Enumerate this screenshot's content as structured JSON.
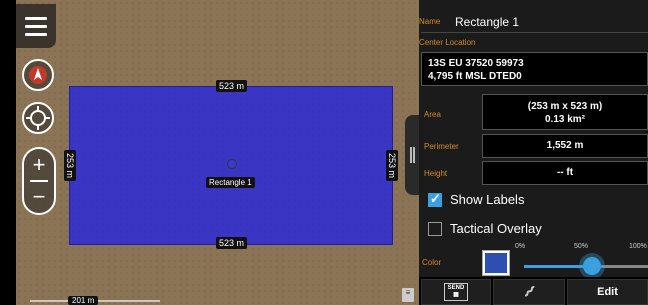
{
  "map": {
    "shape_top_label": "523 m",
    "shape_bottom_label": "523 m",
    "shape_left_label": "253 m",
    "shape_right_label": "253 m",
    "shape_name_label": "Rectangle 1",
    "scale_label": "201 m"
  },
  "panel": {
    "name_label": "Name",
    "name_value": "Rectangle 1",
    "center_location_label": "Center Location",
    "center_location_line1": "13S EU 37520 59973",
    "center_location_line2": "4,795 ft MSL DTED0",
    "area_label": "Area",
    "area_line1": "(253 m x 523 m)",
    "area_line2": "0.13 km²",
    "perimeter_label": "Perimeter",
    "perimeter_value": "1,552 m",
    "height_label": "Height",
    "height_value": "-- ft",
    "show_labels": "Show Labels",
    "show_labels_checked": true,
    "tactical_overlay": "Tactical Overlay",
    "tactical_overlay_checked": false,
    "color_label": "Color",
    "color_value": "#2f4fb0",
    "opacity_ticks": [
      "0%",
      "50%",
      "100%"
    ],
    "opacity_fraction": 0.55,
    "send_label": "SEND",
    "edit_label": "Edit"
  }
}
